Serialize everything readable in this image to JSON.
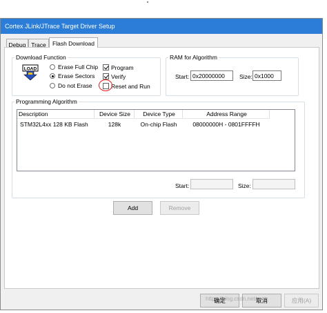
{
  "window": {
    "title": "Cortex JLink/JTrace Target Driver Setup"
  },
  "tabs": [
    {
      "label": "Debug"
    },
    {
      "label": "Trace"
    },
    {
      "label": "Flash Download"
    }
  ],
  "download_function": {
    "label": "Download Function",
    "icon_text": "LOAD",
    "radios": [
      {
        "label": "Erase Full Chip",
        "selected": false
      },
      {
        "label": "Erase Sectors",
        "selected": true
      },
      {
        "label": "Do not Erase",
        "selected": false
      }
    ],
    "checkboxes": [
      {
        "label": "Program",
        "checked": true
      },
      {
        "label": "Verify",
        "checked": true
      },
      {
        "label": "Reset and Run",
        "checked": false
      }
    ]
  },
  "ram": {
    "label": "RAM for Algorithm",
    "start_label": "Start:",
    "start_value": "0x20000000",
    "size_label": "Size:",
    "size_value": "0x1000"
  },
  "programming": {
    "label": "Programming Algorithm",
    "columns": [
      "Description",
      "Device Size",
      "Device Type",
      "Address Range"
    ],
    "rows": [
      [
        "STM32L4xx 128 KB Flash",
        "128k",
        "On-chip Flash",
        "08000000H - 0801FFFFH"
      ]
    ],
    "start_label": "Start:",
    "start_value": "",
    "size_label": "Size:",
    "size_value": ""
  },
  "buttons": {
    "add": "Add",
    "remove": "Remove",
    "ok": "确定",
    "cancel": "取消",
    "apply": "应用(A)"
  },
  "watermark": "https://blog.csdn.net/..."
}
